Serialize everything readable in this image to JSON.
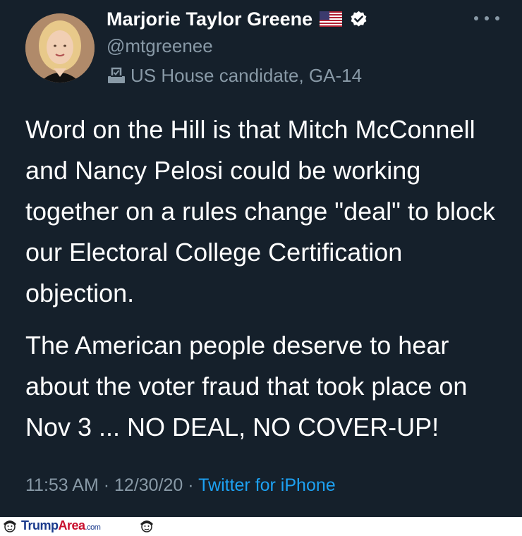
{
  "author": {
    "name": "Marjorie Taylor Greene",
    "handle": "@mtgreenee",
    "bio": "US House candidate, GA-14",
    "flag_icon": "us-flag-icon",
    "verified_icon": "verified-badge-icon",
    "bio_icon": "ballot-box-icon"
  },
  "tweet": {
    "paragraphs": [
      "Word on the Hill is that Mitch McConnell and Nancy Pelosi could be working together on a rules change \"deal\" to block our Electoral College Certification objection.",
      "The American people deserve to hear about the voter fraud that took place on Nov 3 ... NO DEAL, NO COVER-UP!"
    ]
  },
  "meta": {
    "time": "11:53 AM",
    "separator": "·",
    "date": "12/30/20",
    "source": "Twitter for iPhone"
  },
  "watermark": {
    "part1": "Trump",
    "part2": "Area",
    "part3": ".com"
  },
  "colors": {
    "background": "#15202b",
    "secondary_text": "#8899a6",
    "link": "#1da1f2"
  }
}
